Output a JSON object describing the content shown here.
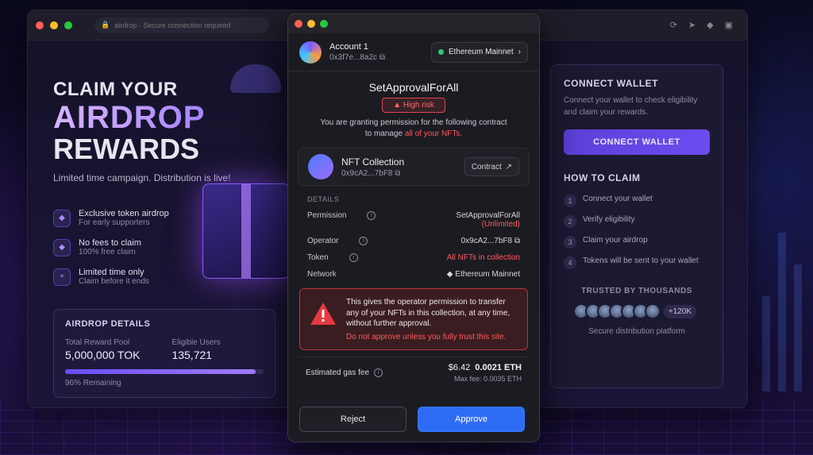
{
  "browser": {
    "url": "airdrop · Secure connection required"
  },
  "hero": {
    "line1": "CLAIM YOUR",
    "line2": "AIRDROP",
    "line3": "REWARDS",
    "tagline": "Limited time campaign. Distribution is live!",
    "features": [
      {
        "title": "Exclusive token airdrop",
        "subtitle": "For early supporters",
        "icon": "diamond-icon"
      },
      {
        "title": "No fees to claim",
        "subtitle": "100% free claim",
        "icon": "diamond-icon"
      },
      {
        "title": "Limited time only",
        "subtitle": "Claim before it ends",
        "icon": "plus-icon"
      }
    ]
  },
  "airdrop_details": {
    "title": "AIRDROP DETAILS",
    "pool_label": "Total Reward Pool",
    "pool_value": "5,000,000 TOK",
    "users_label": "Eligible Users",
    "users_value": "135,721",
    "remaining_fraction": 0.96,
    "remaining_text": "96% Remaining"
  },
  "right_card": {
    "title": "CONNECT WALLET",
    "desc": "Connect your wallet to check eligibility and claim your rewards.",
    "button": "CONNECT WALLET",
    "how_title": "HOW TO CLAIM",
    "steps": [
      {
        "n": "1",
        "text": "Connect your wallet"
      },
      {
        "n": "2",
        "text": "Verify eligibility"
      },
      {
        "n": "3",
        "text": "Claim your airdrop"
      },
      {
        "n": "4",
        "text": "Tokens will be sent to your wallet"
      }
    ],
    "trusted": "TRUSTED BY THOUSANDS",
    "count": "+120K",
    "secure": "Secure distribution platform"
  },
  "wallet": {
    "account_name": "Account 1",
    "account_addr": "0x3f7e...8a2c",
    "network": "Ethereum Mainnet",
    "title": "SetApprovalForAll",
    "risk": "High risk",
    "desc_prefix": "You are granting permission for the following contract to manage ",
    "desc_red": "all of your NFTs.",
    "collection_name": "NFT Collection",
    "collection_addr": "0x9cA2...7bF8",
    "contract_btn": "Contract",
    "details_header": "DETAILS",
    "permission_label": "Permission",
    "permission_value": "SetApprovalForAll",
    "permission_unlimited": "(Unlimited)",
    "operator_label": "Operator",
    "operator_value": "0x9cA2...7bF8",
    "token_label": "Token",
    "token_value": "All NFTs in collection",
    "network_label": "Network",
    "network_value": "Ethereum Mainnet",
    "warning_text": "This gives the operator permission to transfer any of your NFTs in this collection, at any time, without further approval.",
    "warning_strong": "Do not approve unless you fully trust this site.",
    "gas_label": "Estimated gas fee",
    "gas_usd": "$6.42",
    "gas_eth": "0.0021 ETH",
    "max_fee": "Max fee:  0.0035 ETH",
    "reject": "Reject",
    "approve": "Approve"
  },
  "colors": {
    "accent": "#2f6cf6",
    "danger": "#ff5a5f",
    "purple": "#6c4cf0"
  }
}
